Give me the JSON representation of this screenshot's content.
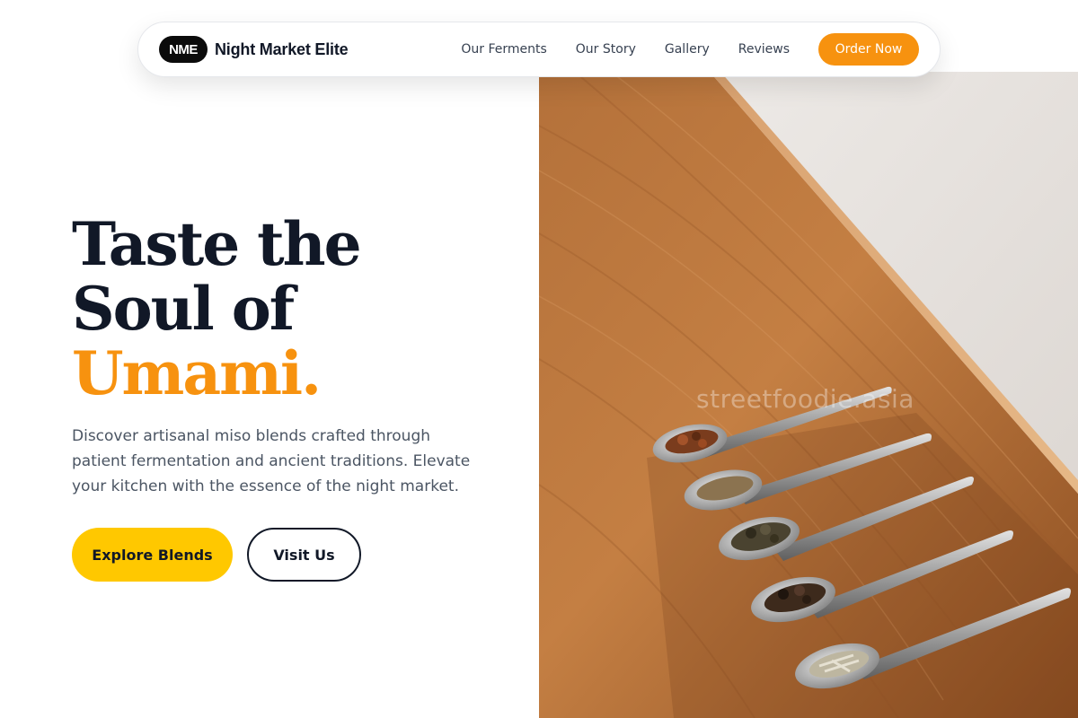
{
  "brand": {
    "badge": "NME",
    "name": "Night Market Elite"
  },
  "nav": {
    "links": [
      {
        "label": "Our Ferments"
      },
      {
        "label": "Our Story"
      },
      {
        "label": "Gallery"
      },
      {
        "label": "Reviews"
      }
    ],
    "cta": "Order Now"
  },
  "hero": {
    "title_line1": "Taste the",
    "title_line2": "Soul of",
    "title_accent": "Umami.",
    "description": "Discover artisanal miso blends crafted through patient fermentation and ancient traditions. Elevate your kitchen with the essence of the night market.",
    "primary_button": "Explore Blends",
    "secondary_button": "Visit Us"
  },
  "image": {
    "watermark": "streetfoodie.asia",
    "subject": "five tasting spoons with dried tea leaves on a wooden board"
  },
  "colors": {
    "accent_orange": "#f7920f",
    "button_yellow": "#ffc800",
    "ink": "#111827",
    "body_text": "#4b5563"
  }
}
